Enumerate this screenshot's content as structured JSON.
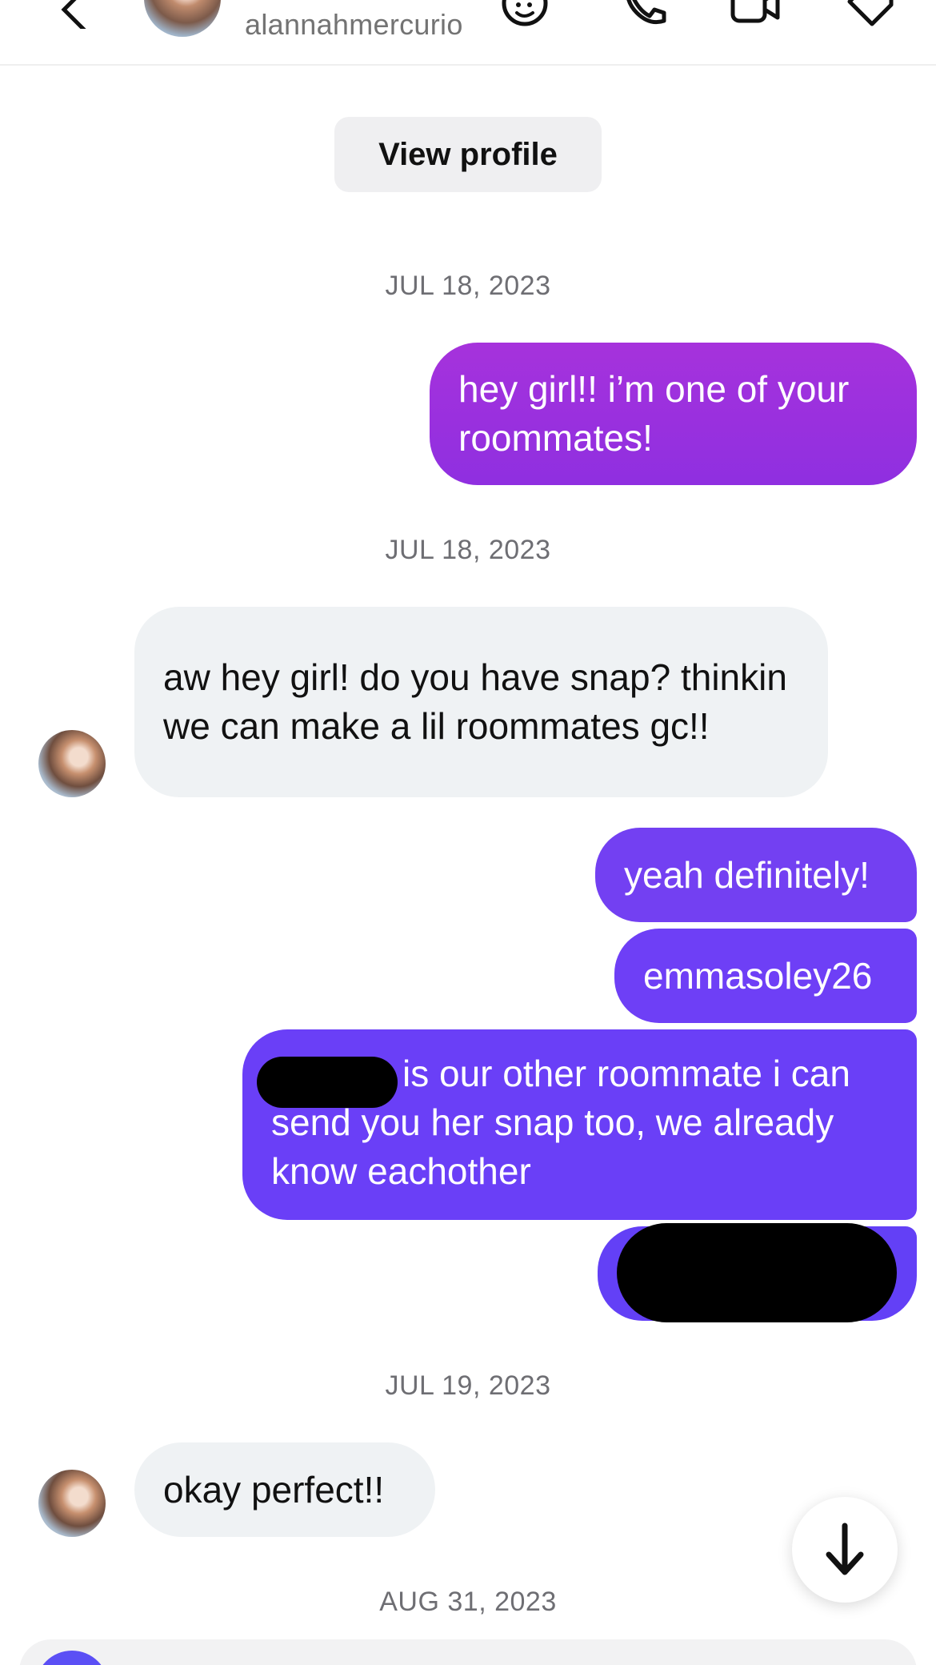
{
  "header": {
    "username": "alannahmercurio",
    "icons": [
      "back-icon",
      "emoji-icon",
      "phone-icon",
      "video-icon",
      "tag-icon"
    ]
  },
  "view_profile_label": "View profile",
  "dates": {
    "d1": "JUL 18, 2023",
    "d2": "JUL 18, 2023",
    "d3": "JUL 19, 2023",
    "d4": "AUG 31, 2023"
  },
  "messages": {
    "m1": "hey girl!! i’m one of your roommates!",
    "m2": "aw hey girl! do you have snap? thinkin we can make a lil roommates gc!!",
    "m3": "yeah definitely!",
    "m4": "emmasoley26",
    "m5": "is our other roommate i can send you her snap too, we already know eachother",
    "m7": "okay perfect!!"
  },
  "colors": {
    "sent_purple_top": "#a632dc",
    "sent_purple_bottom": "#8f2fe0",
    "sent_indigo": "#6a3ff7",
    "received_bg": "#eff2f4",
    "date_text": "#6e6e73",
    "composer_accent": "#5b4ff5"
  }
}
